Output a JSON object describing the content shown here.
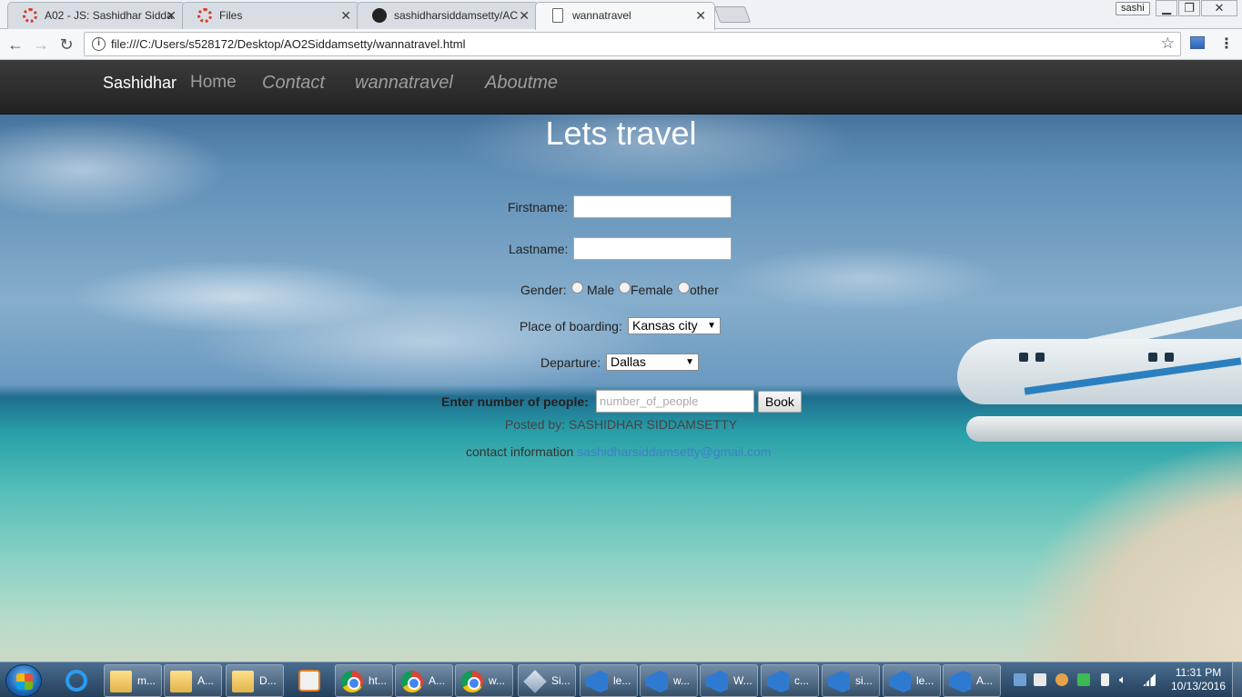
{
  "browser": {
    "tabs": [
      {
        "title": "A02 - JS: Sashidhar Sidda",
        "favicon": "loading-ring-icon",
        "active": false
      },
      {
        "title": "Files",
        "favicon": "loading-ring-icon",
        "active": false
      },
      {
        "title": "sashidharsiddamsetty/AC",
        "favicon": "github-icon",
        "active": false
      },
      {
        "title": "wannatravel",
        "favicon": "page-icon",
        "active": true
      }
    ],
    "profile_name": "sashi",
    "url": "file:///C:/Users/s528172/Desktop/AO2Siddamsetty/wannatravel.html"
  },
  "page": {
    "navbar": {
      "brand": "Sashidhar",
      "links": [
        "Home",
        "Contact",
        "wannatravel",
        "Aboutme"
      ]
    },
    "heading": "Lets travel",
    "form": {
      "firstname_label": "Firstname:",
      "lastname_label": "Lastname:",
      "gender_label": "Gender:",
      "gender_options": [
        "Male",
        "Female",
        "other"
      ],
      "boarding_label": "Place of boarding:",
      "boarding_value": "Kansas city",
      "departure_label": "Departure:",
      "departure_value": "Dallas",
      "people_label": "Enter number of people:",
      "people_placeholder": "number_of_people",
      "book_label": "Book"
    },
    "posted_by": "Posted by: SASHIDHAR SIDDAMSETTY",
    "contact_label": "contact information",
    "contact_email": "sashidharsiddamsetty@gmail.com"
  },
  "taskbar": {
    "items": [
      "m...",
      "A...",
      "D...",
      "ht...",
      "A...",
      "w...",
      "Si...",
      "le...",
      "w...",
      "W...",
      "c...",
      "si...",
      "le...",
      "A..."
    ],
    "time": "11:31 PM",
    "date": "10/13/2016"
  }
}
